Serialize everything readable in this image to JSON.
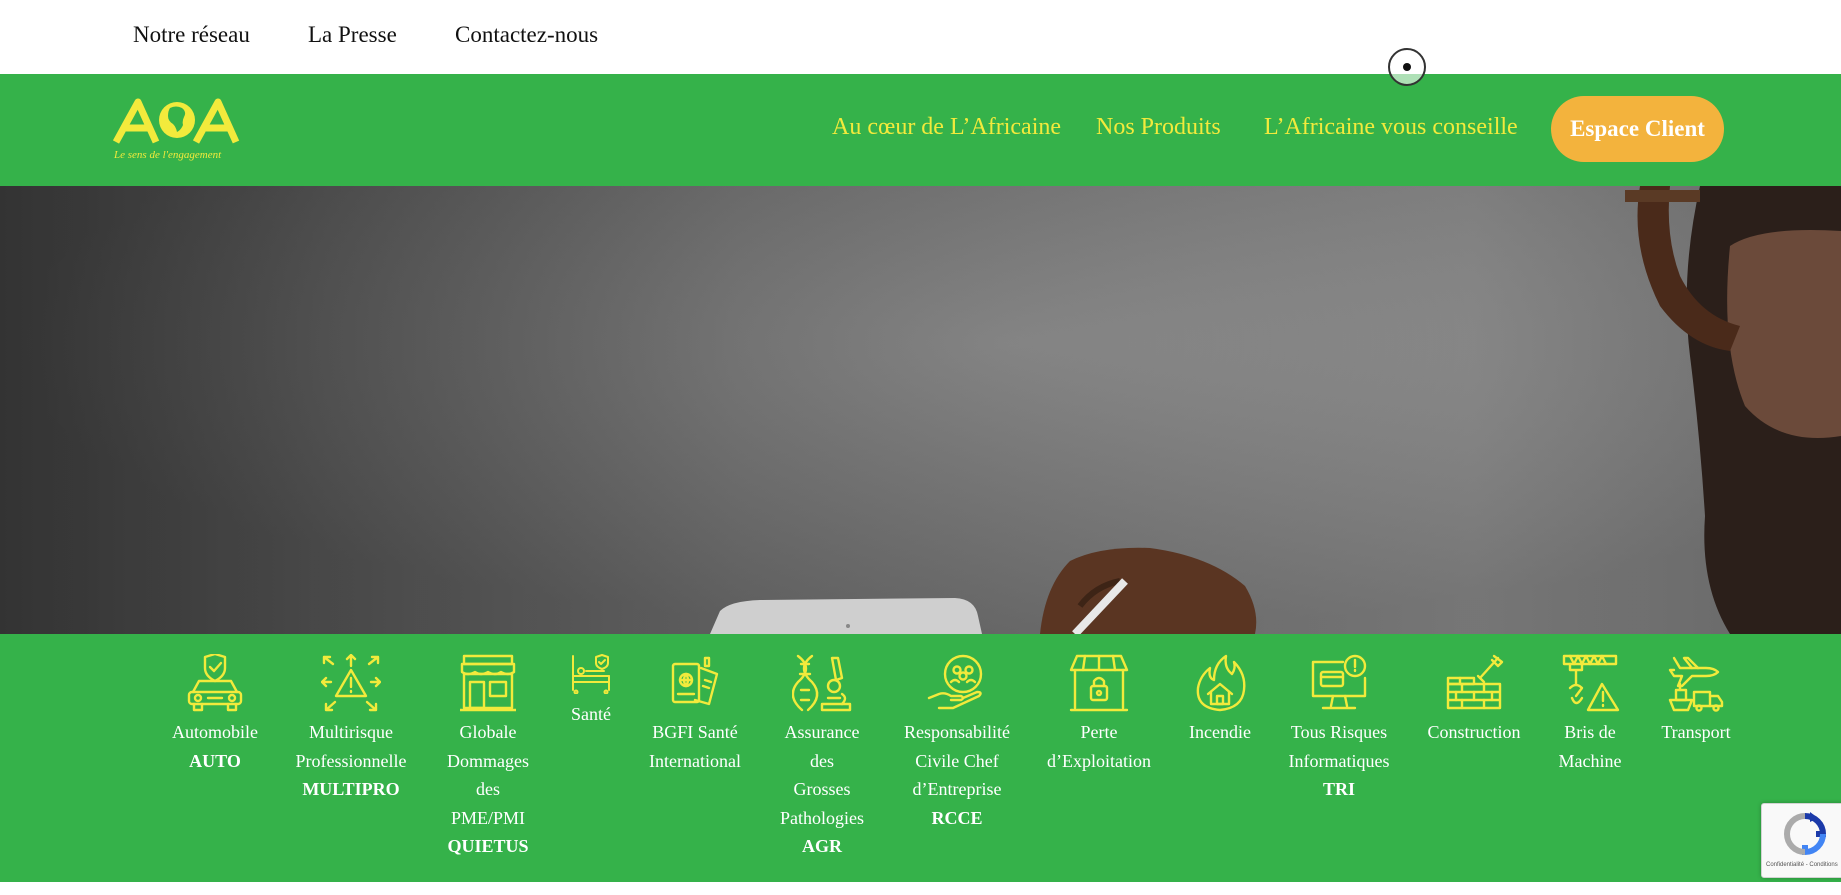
{
  "top_links": [
    "Notre réseau",
    "La Presse",
    "Contactez-nous"
  ],
  "logo": {
    "text": "Le sens de l'engagement"
  },
  "nav": {
    "items": [
      "Au cœur de L’Africaine",
      "Nos Produits",
      "L’Africaine vous conseille"
    ],
    "cta": "Espace Client"
  },
  "colors": {
    "green": "#35b24a",
    "yellow": "#f2ea3c",
    "orange": "#f3b33d"
  },
  "products": [
    {
      "name": [
        "Automobile"
      ],
      "code": "AUTO",
      "icon": "car-shield-icon"
    },
    {
      "name": [
        "Multirisque",
        "Professionnelle"
      ],
      "code": "MULTIPRO",
      "icon": "warning-arrows-icon"
    },
    {
      "name": [
        "Globale",
        "Dommages",
        "des",
        "PME/PMI"
      ],
      "code": "QUIETUS",
      "icon": "shop-icon"
    },
    {
      "name": [
        "Santé"
      ],
      "code": "",
      "icon": "hospital-bed-icon"
    },
    {
      "name": [
        "BGFI Santé",
        "International"
      ],
      "code": "",
      "icon": "passport-icon"
    },
    {
      "name": [
        "Assurance",
        "des Grosses",
        "Pathologies"
      ],
      "code": "AGR",
      "icon": "dna-microscope-icon"
    },
    {
      "name": [
        "Responsabilité",
        "Civile Chef",
        "d’Entreprise"
      ],
      "code": "RCCE",
      "icon": "hand-group-icon"
    },
    {
      "name": [
        "Perte",
        "d’Exploitation"
      ],
      "code": "",
      "icon": "shop-lock-icon"
    },
    {
      "name": [
        "Incendie"
      ],
      "code": "",
      "icon": "fire-house-icon"
    },
    {
      "name": [
        "Tous Risques",
        "Informatiques"
      ],
      "code": "TRI",
      "icon": "computer-alert-icon"
    },
    {
      "name": [
        "Construction"
      ],
      "code": "",
      "icon": "brick-wall-icon"
    },
    {
      "name": [
        "Bris de",
        "Machine"
      ],
      "code": "",
      "icon": "crane-warning-icon"
    },
    {
      "name": [
        "Transport"
      ],
      "code": "",
      "icon": "plane-ship-truck-icon"
    }
  ],
  "recaptcha": {
    "text": "Confidentialité - Conditions"
  }
}
